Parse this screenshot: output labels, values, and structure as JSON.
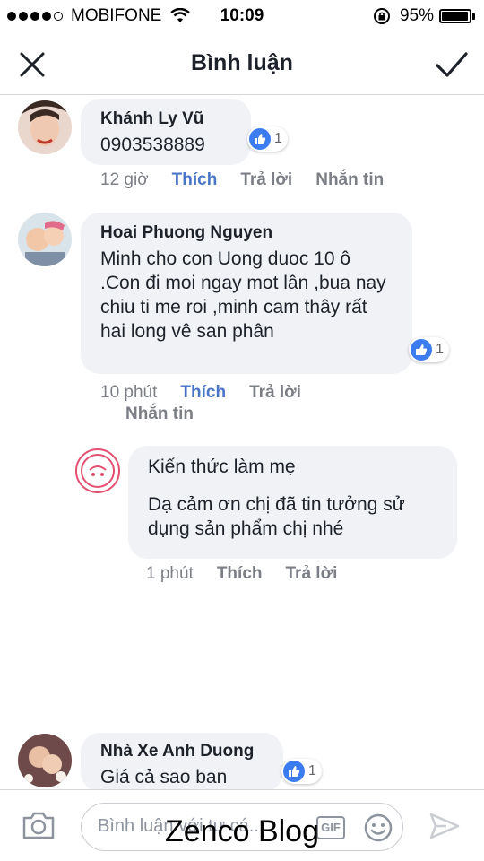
{
  "status_bar": {
    "carrier": "MOBIFONE",
    "time": "10:09",
    "battery": "95%",
    "battery_level": 0.95
  },
  "header": {
    "title": "Bình luận",
    "close_icon": "close-icon",
    "confirm_icon": "check-icon"
  },
  "comments": [
    {
      "author": "Khánh Ly Vũ",
      "text": "0903538889",
      "reactions": "1",
      "time": "12 giờ",
      "like": "Thích",
      "reply": "Trả lời",
      "message": "Nhắn tin"
    },
    {
      "author": "Hoai Phuong Nguyen",
      "text": "Minh cho con Uong duoc 10 ô .Con đi  moi ngay mot lân ,bua nay chiu ti me roi ,minh cam thây rất hai long vê san phân",
      "reactions": "1",
      "time": "10 phút",
      "like": "Thích",
      "reply": "Trả lời",
      "message": "Nhắn tin"
    },
    {
      "author": "Kiến thức làm mẹ",
      "text": "Dạ cảm ơn chị đã tin tưởng sử dụng sản phẩm chị nhé",
      "time": "1 phút",
      "like": "Thích",
      "reply": "Trả lời"
    },
    {
      "author": "Nhà Xe Anh Duong",
      "text": "Giá cả sao ban",
      "reactions": "1"
    }
  ],
  "composer": {
    "placeholder": "Bình luận với tư cá...",
    "gif_label": "GIF"
  },
  "watermark": "Zenco Blog",
  "colors": {
    "like_blue": "#3b7cf0",
    "link_blue": "#4a76c7",
    "bubble_bg": "#f0f2f5",
    "meta_gray": "#7b7f85"
  }
}
